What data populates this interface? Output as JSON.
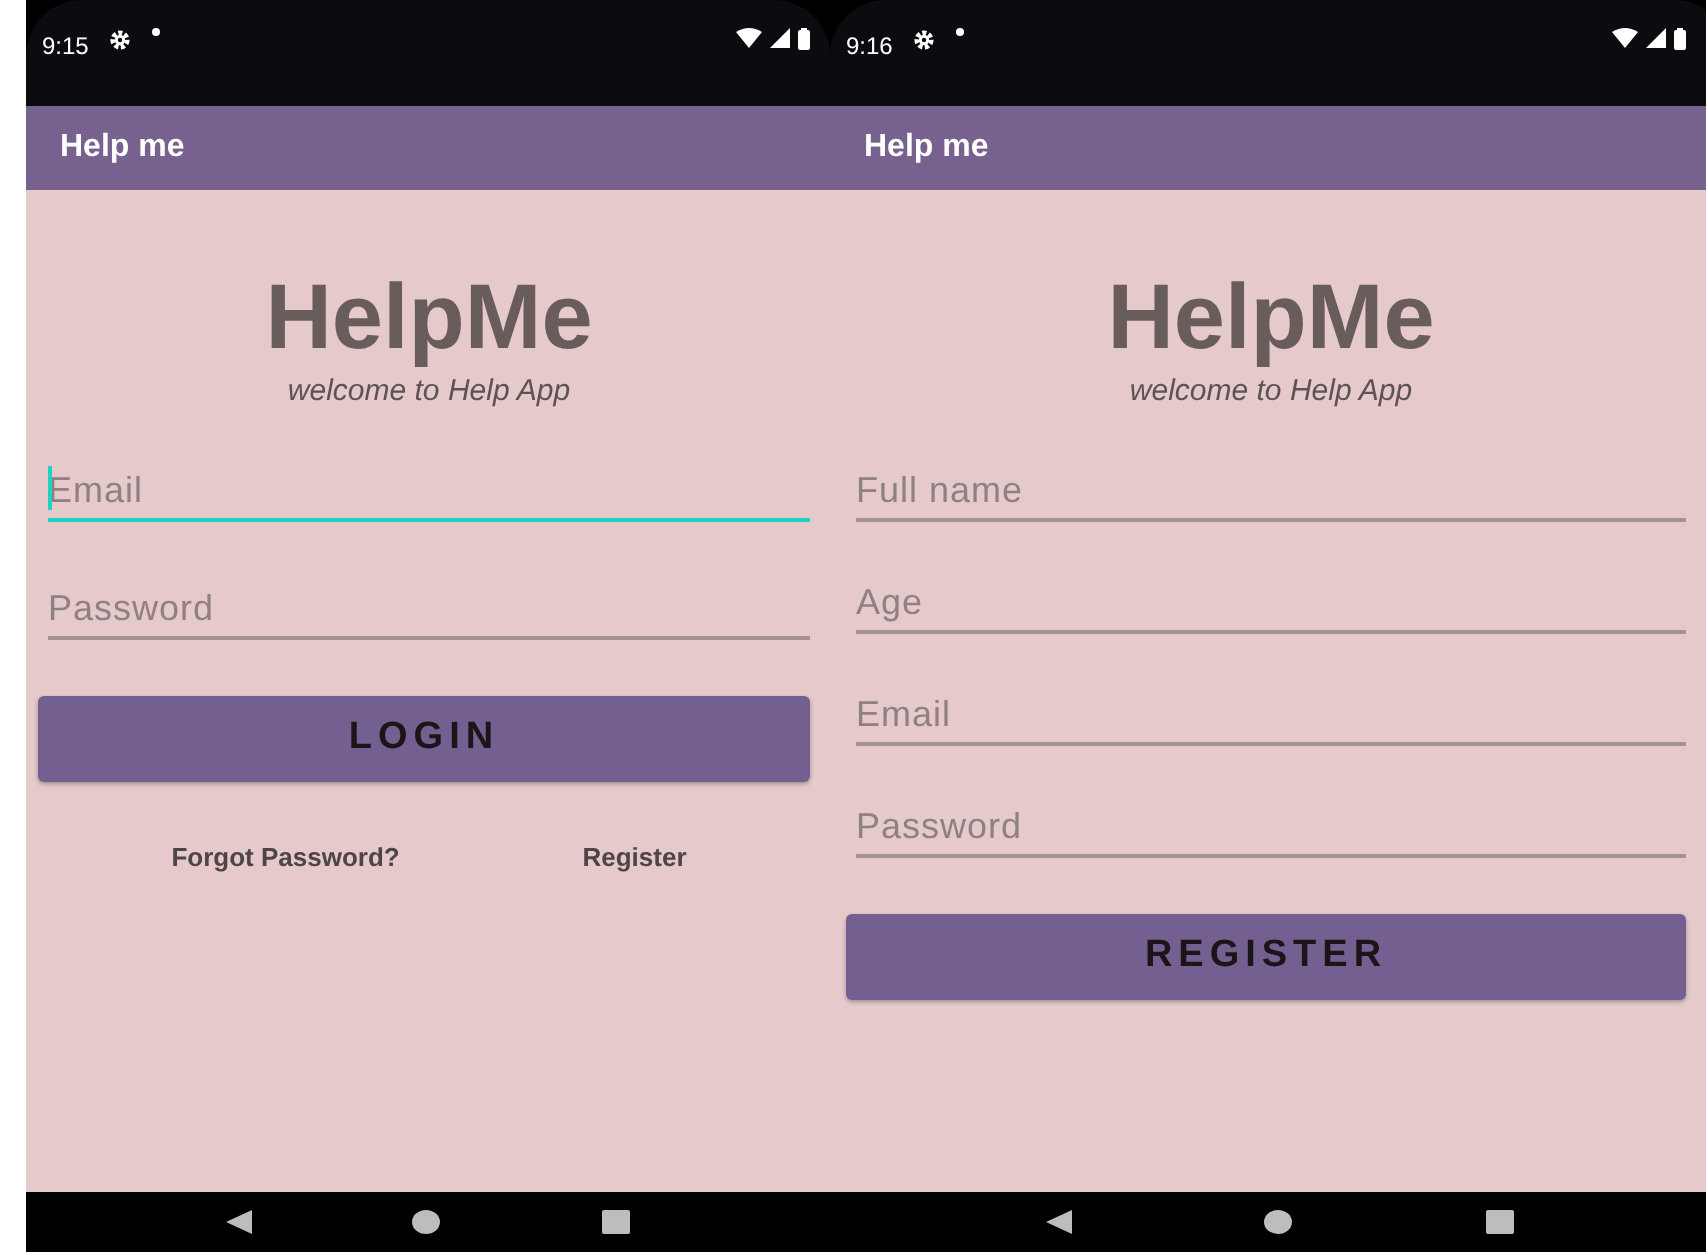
{
  "screens": [
    {
      "status_time": "9:15",
      "app_title": "Help me",
      "logo": "HelpMe",
      "tagline": "welcome to Help App",
      "fields": [
        {
          "placeholder": "Email",
          "focused": true
        },
        {
          "placeholder": "Password",
          "focused": false
        }
      ],
      "button": "LOGIN",
      "links": [
        "Forgot Password?",
        "Register"
      ]
    },
    {
      "status_time": "9:16",
      "app_title": "Help me",
      "logo": "HelpMe",
      "tagline": "welcome to Help App",
      "fields": [
        {
          "placeholder": "Full name",
          "focused": false
        },
        {
          "placeholder": "Age",
          "focused": false
        },
        {
          "placeholder": "Email",
          "focused": false
        },
        {
          "placeholder": "Password",
          "focused": false
        }
      ],
      "button": "REGISTER"
    }
  ]
}
